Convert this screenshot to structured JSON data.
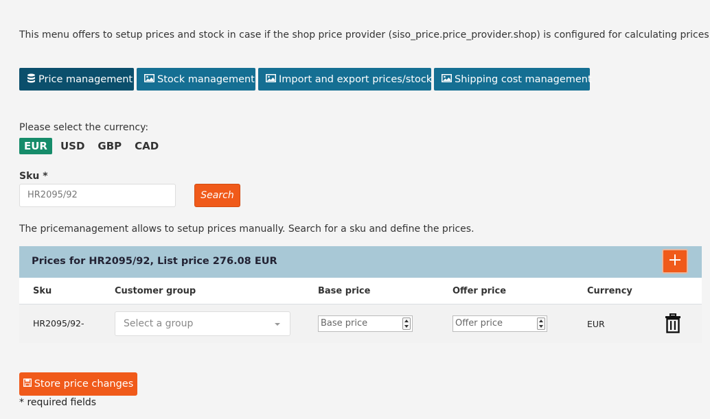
{
  "intro": "This menu offers to setup prices and stock in case if the shop price provider (siso_price.price_provider.shop) is configured for calculating prices.",
  "tabs": [
    {
      "label": "Price management",
      "icon": "database-icon"
    },
    {
      "label": "Stock management",
      "icon": "image-icon"
    },
    {
      "label": "Import and export prices/stock",
      "icon": "image-icon"
    },
    {
      "label": "Shipping cost management",
      "icon": "image-icon"
    }
  ],
  "currency": {
    "label": "Please select the currency:",
    "options": [
      "EUR",
      "USD",
      "GBP",
      "CAD"
    ],
    "selected": "EUR"
  },
  "sku": {
    "label": "Sku *",
    "value": "HR2095/92",
    "search_label": "Search"
  },
  "pm_description": "The pricemanagement allows to setup prices manually. Search for a sku and define the prices.",
  "panel": {
    "title": "Prices for HR2095/92, List price 276.08 EUR",
    "add_icon": "plus-icon",
    "columns": [
      "Sku",
      "Customer group",
      "Base price",
      "Offer price",
      "Currency"
    ],
    "rows": [
      {
        "sku": "HR2095/92-",
        "group_placeholder": "Select a group",
        "base_placeholder": "Base price",
        "offer_placeholder": "Offer price",
        "currency": "EUR"
      }
    ]
  },
  "store_label": "Store price changes",
  "required_note": "* required fields",
  "colors": {
    "tab": "#156f93",
    "tab_active": "#0b4f6c",
    "accent": "#f05a1a",
    "currency_active": "#168c6a",
    "panel_head": "#a8c8d6"
  }
}
